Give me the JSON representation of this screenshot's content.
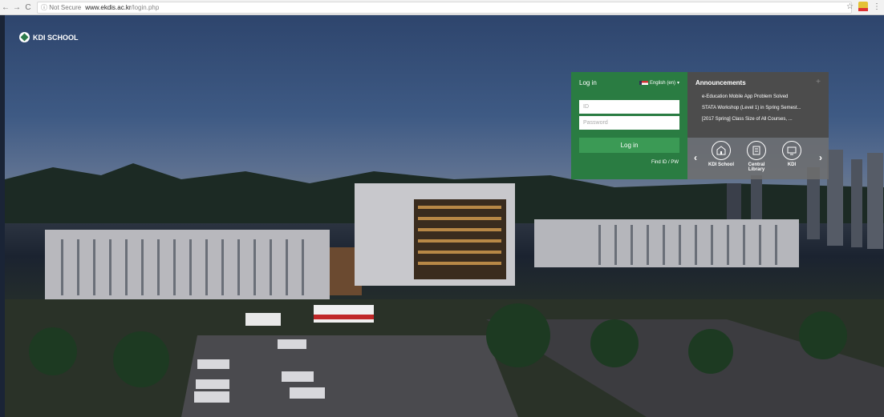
{
  "browser": {
    "security_label": "ⓘ Not Secure",
    "host": "www.ekdis.ac.kr",
    "path": "/login.php"
  },
  "brand": {
    "name": "KDI SCHOOL"
  },
  "login": {
    "title": "Log in",
    "language": "English (en)",
    "id_placeholder": "ID",
    "password_placeholder": "Password",
    "button": "Log in",
    "find_link": "Find ID / PW"
  },
  "announcements": {
    "title": "Announcements",
    "plus": "+",
    "items": [
      "e-Education Mobile App Problem Solved",
      "STATA Workshop (Level 1) in Spring Semest...",
      "[2017 Spring] Class Size of All Courses, ..."
    ]
  },
  "shortcuts": [
    {
      "label": "KDI School",
      "icon": "building-icon"
    },
    {
      "label": "Central Library",
      "icon": "book-icon"
    },
    {
      "label": "KDI",
      "icon": "monitor-icon"
    }
  ],
  "colors": {
    "login_green": "#2a7c42",
    "button_green": "#3b9a55",
    "announcement_gray": "#4c4c4c"
  }
}
